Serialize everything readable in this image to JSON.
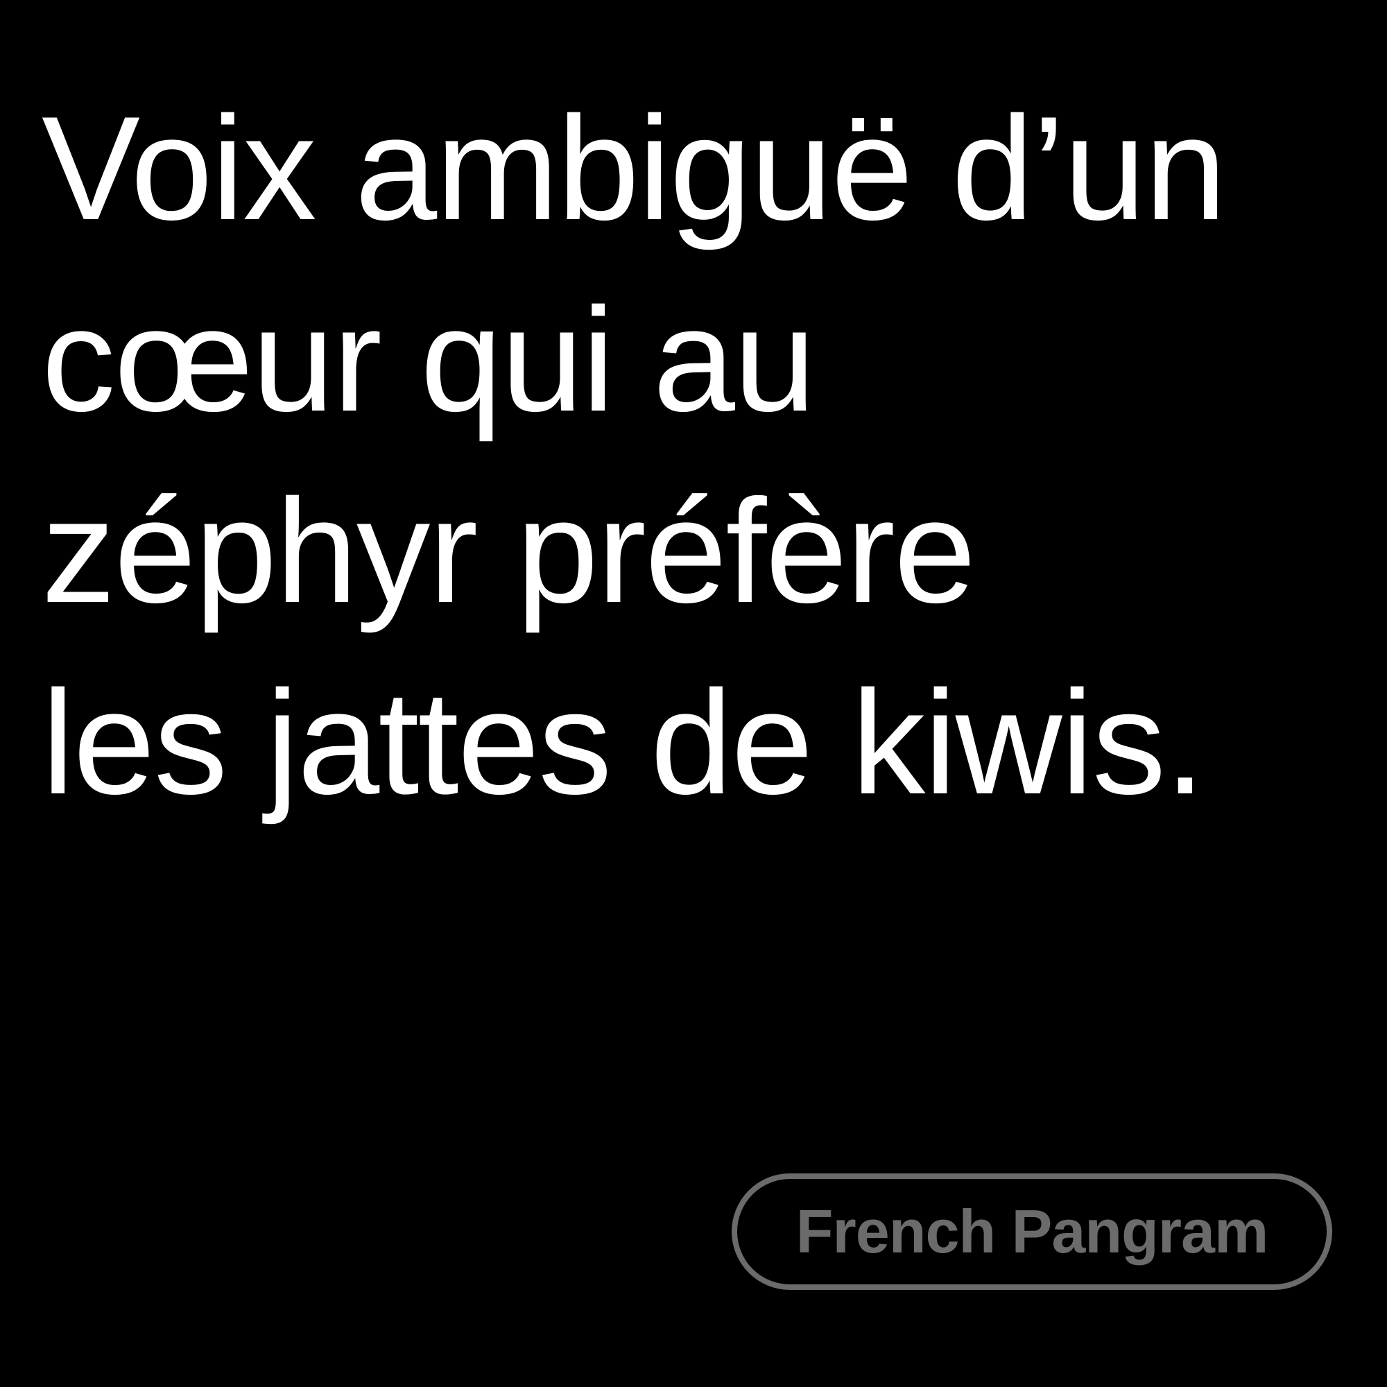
{
  "pangram": {
    "lines": [
      "Voix ambiguë d’un",
      "cœur qui au",
      "zéphyr préfère",
      "les jattes de kiwis."
    ]
  },
  "badge": {
    "label": "French Pangram"
  },
  "colors": {
    "background": "#000000",
    "text": "#ffffff",
    "badge": "#6b6b6b"
  }
}
